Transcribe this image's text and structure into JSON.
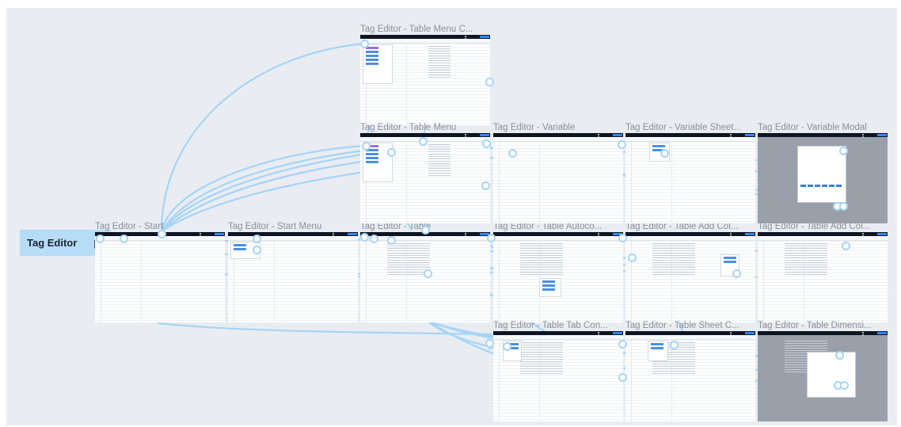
{
  "flow": {
    "label": "Tag Editor",
    "start_icon": "play-outline-icon"
  },
  "frames": [
    {
      "key": "start",
      "title": "Tag Editor - Start"
    },
    {
      "key": "start_menu",
      "title": "Tag Editor - Start Menu"
    },
    {
      "key": "table",
      "title": "Tag Editor - Table"
    },
    {
      "key": "table_autoco",
      "title": "Tag Editor - Table Autoco..."
    },
    {
      "key": "table_add_col_1",
      "title": "Tag Editor - Table Add Col..."
    },
    {
      "key": "table_add_col_2",
      "title": "Tag Editor - Table Add Col..."
    },
    {
      "key": "table_menu_c",
      "title": "Tag Editor - Table Menu C..."
    },
    {
      "key": "table_menu",
      "title": "Tag Editor - Table Menu"
    },
    {
      "key": "variable",
      "title": "Tag Editor - Variable"
    },
    {
      "key": "variable_sheet",
      "title": "Tag Editor - Variable Sheet..."
    },
    {
      "key": "variable_modal",
      "title": "Tag Editor - Variable Modal"
    },
    {
      "key": "table_tab_con",
      "title": "Tag Editor - Table Tab Con..."
    },
    {
      "key": "table_sheet_c",
      "title": "Tag Editor - Table Sheet C..."
    },
    {
      "key": "table_dimensi",
      "title": "Tag Editor - Table Dimensi..."
    }
  ],
  "colors": {
    "canvas": "#e9edf2",
    "connector": "#a6d4f6",
    "start_label_bg": "#b6dcf7",
    "app_topbar": "#0e1522",
    "accent": "#2f86ff"
  }
}
